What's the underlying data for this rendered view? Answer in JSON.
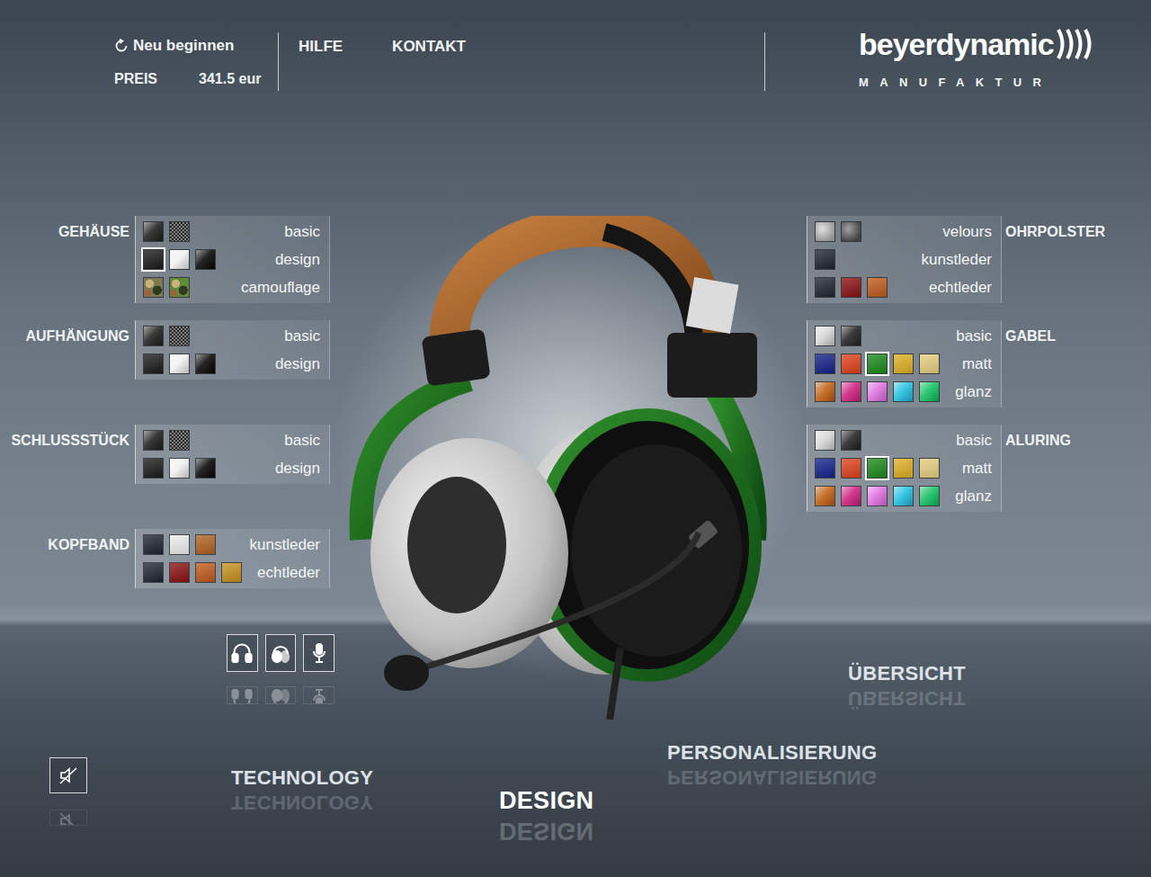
{
  "header": {
    "restart": "Neu beginnen",
    "price_label": "PREIS",
    "price": "341.5 eur",
    "links": [
      "HILFE",
      "KONTAKT"
    ]
  },
  "logo": {
    "brand": "beyerdynamic",
    "sub": "MANUFAKTUR"
  },
  "left_groups": [
    {
      "title": "GEHÄUSE",
      "rows": [
        {
          "label": "basic",
          "swatches": [
            {
              "color": "#1e1e1e",
              "kind": "gloss",
              "selected": false
            },
            {
              "color": "#3a3a3a",
              "kind": "pattern",
              "selected": false
            }
          ]
        },
        {
          "label": "design",
          "swatches": [
            {
              "color": "#1a1a1a",
              "kind": "solid",
              "selected": true
            },
            {
              "color": "#f2f2f2",
              "kind": "gloss",
              "selected": false
            },
            {
              "color": "#050505",
              "kind": "gloss",
              "selected": false
            }
          ]
        },
        {
          "label": "camouflage",
          "swatches": [
            {
              "color": "#7c7a52",
              "kind": "camo",
              "selected": false
            },
            {
              "color": "#5f8a3a",
              "kind": "camo",
              "selected": false
            }
          ]
        }
      ]
    },
    {
      "title": "AUFHÄNGUNG",
      "rows": [
        {
          "label": "basic",
          "swatches": [
            {
              "color": "#1e1e1e",
              "kind": "gloss",
              "selected": false
            },
            {
              "color": "#3a3a3a",
              "kind": "pattern",
              "selected": false
            }
          ]
        },
        {
          "label": "design",
          "swatches": [
            {
              "color": "#1a1a1a",
              "kind": "solid",
              "selected": false
            },
            {
              "color": "#f2f2f2",
              "kind": "gloss",
              "selected": false
            },
            {
              "color": "#050505",
              "kind": "gloss",
              "selected": false
            }
          ]
        }
      ]
    },
    {
      "title": "SCHLUSSSTÜCK",
      "rows": [
        {
          "label": "basic",
          "swatches": [
            {
              "color": "#1e1e1e",
              "kind": "gloss",
              "selected": false
            },
            {
              "color": "#3a3a3a",
              "kind": "pattern",
              "selected": false
            }
          ]
        },
        {
          "label": "design",
          "swatches": [
            {
              "color": "#1a1a1a",
              "kind": "solid",
              "selected": false
            },
            {
              "color": "#f2f2f2",
              "kind": "gloss",
              "selected": false
            },
            {
              "color": "#050505",
              "kind": "gloss",
              "selected": false
            }
          ]
        }
      ]
    },
    {
      "title": "KOPFBAND",
      "rows": [
        {
          "label": "kunstleder",
          "swatches": [
            {
              "color": "#1c2430",
              "kind": "solid",
              "selected": false
            },
            {
              "color": "#f0f0f0",
              "kind": "solid",
              "selected": false
            },
            {
              "color": "#b0621e",
              "kind": "solid",
              "selected": false
            }
          ]
        },
        {
          "label": "echtleder",
          "swatches": [
            {
              "color": "#1c2430",
              "kind": "solid",
              "selected": false
            },
            {
              "color": "#8b1010",
              "kind": "solid",
              "selected": false
            },
            {
              "color": "#c05a1a",
              "kind": "solid",
              "selected": false
            },
            {
              "color": "#c8901a",
              "kind": "solid",
              "selected": false
            }
          ]
        }
      ]
    }
  ],
  "right_groups": [
    {
      "title": "OHRPOLSTER",
      "rows": [
        {
          "label": "velours",
          "swatches": [
            {
              "color": "#c8c8c8",
              "kind": "texture",
              "selected": false
            },
            {
              "color": "#555555",
              "kind": "texture",
              "selected": false
            }
          ]
        },
        {
          "label": "kunstleder",
          "swatches": [
            {
              "color": "#1c2430",
              "kind": "solid",
              "selected": false
            }
          ]
        },
        {
          "label": "echtleder",
          "swatches": [
            {
              "color": "#1c2430",
              "kind": "solid",
              "selected": false
            },
            {
              "color": "#8b1010",
              "kind": "solid",
              "selected": false
            },
            {
              "color": "#c05a1a",
              "kind": "solid",
              "selected": false
            }
          ]
        }
      ]
    },
    {
      "title": "GABEL",
      "rows": [
        {
          "label": "basic",
          "swatches": [
            {
              "color": "#d8d8d8",
              "kind": "gloss",
              "selected": false
            },
            {
              "color": "#222222",
              "kind": "gloss",
              "selected": false
            }
          ]
        },
        {
          "label": "matt",
          "swatches": [
            {
              "color": "#10208a",
              "kind": "solid",
              "selected": false
            },
            {
              "color": "#e0401a",
              "kind": "solid",
              "selected": false
            },
            {
              "color": "#1a8a1a",
              "kind": "solid",
              "selected": true
            },
            {
              "color": "#e0b020",
              "kind": "solid",
              "selected": false
            },
            {
              "color": "#e8d080",
              "kind": "solid",
              "selected": false
            }
          ]
        },
        {
          "label": "glanz",
          "swatches": [
            {
              "color": "#c06010",
              "kind": "gloss",
              "selected": false
            },
            {
              "color": "#d02080",
              "kind": "gloss",
              "selected": false
            },
            {
              "color": "#e070e0",
              "kind": "gloss",
              "selected": false
            },
            {
              "color": "#20c0e0",
              "kind": "gloss",
              "selected": false
            },
            {
              "color": "#10c060",
              "kind": "gloss",
              "selected": false
            }
          ]
        }
      ]
    },
    {
      "title": "ALURING",
      "rows": [
        {
          "label": "basic",
          "swatches": [
            {
              "color": "#d8d8d8",
              "kind": "gloss",
              "selected": false
            },
            {
              "color": "#222222",
              "kind": "gloss",
              "selected": false
            }
          ]
        },
        {
          "label": "matt",
          "swatches": [
            {
              "color": "#10208a",
              "kind": "solid",
              "selected": false
            },
            {
              "color": "#e0401a",
              "kind": "solid",
              "selected": false
            },
            {
              "color": "#1a8a1a",
              "kind": "solid",
              "selected": true
            },
            {
              "color": "#e0b020",
              "kind": "solid",
              "selected": false
            },
            {
              "color": "#e8d080",
              "kind": "solid",
              "selected": false
            }
          ]
        },
        {
          "label": "glanz",
          "swatches": [
            {
              "color": "#c06010",
              "kind": "gloss",
              "selected": false
            },
            {
              "color": "#d02080",
              "kind": "gloss",
              "selected": false
            },
            {
              "color": "#e070e0",
              "kind": "gloss",
              "selected": false
            },
            {
              "color": "#20c0e0",
              "kind": "gloss",
              "selected": false
            },
            {
              "color": "#10c060",
              "kind": "gloss",
              "selected": false
            }
          ]
        }
      ]
    }
  ],
  "views": [
    {
      "kind": "front",
      "selected": false
    },
    {
      "kind": "back",
      "selected": false
    },
    {
      "kind": "mic",
      "selected": false
    }
  ],
  "sound": {
    "muted": true
  },
  "nav": [
    {
      "label": "TECHNOLOGY",
      "selected": false
    },
    {
      "label": "DESIGN",
      "selected": true
    },
    {
      "label": "PERSONALISIERUNG",
      "selected": false
    },
    {
      "label": "ÜBERSICHT",
      "selected": false
    }
  ]
}
